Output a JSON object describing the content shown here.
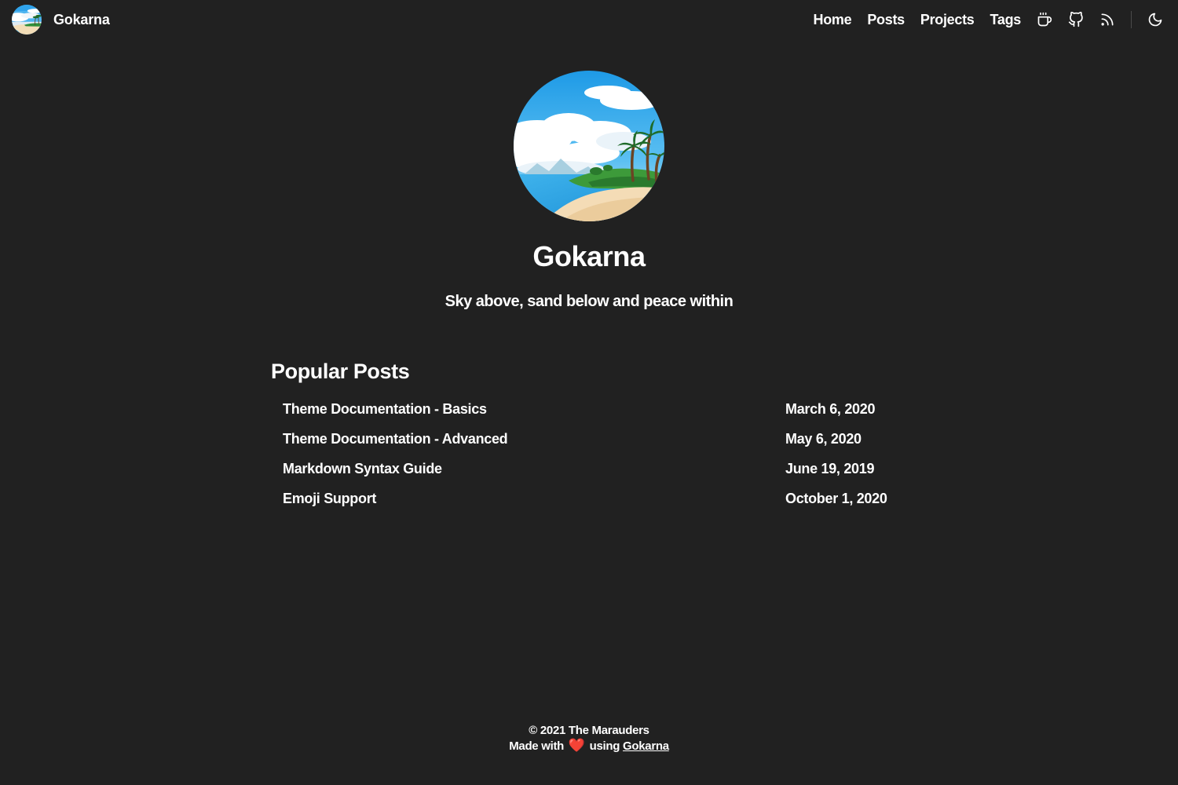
{
  "nav": {
    "brand_name": "Gokarna",
    "links": [
      {
        "label": "Home"
      },
      {
        "label": "Posts"
      },
      {
        "label": "Projects"
      },
      {
        "label": "Tags"
      }
    ],
    "icons": [
      "coffee-cup-icon",
      "github-icon",
      "rss-icon"
    ],
    "theme_toggle_icon": "moon-icon"
  },
  "hero": {
    "title": "Gokarna",
    "tagline": "Sky above, sand below and peace within"
  },
  "popular_posts": {
    "heading": "Popular Posts",
    "items": [
      {
        "title": "Theme Documentation - Basics",
        "date": "March 6, 2020"
      },
      {
        "title": "Theme Documentation - Advanced",
        "date": "May 6, 2020"
      },
      {
        "title": "Markdown Syntax Guide",
        "date": "June 19, 2019"
      },
      {
        "title": "Emoji Support",
        "date": "October 1, 2020"
      }
    ]
  },
  "footer": {
    "copyright": "© 2021 The Marauders",
    "made_with": "Made with",
    "heart": "❤️",
    "using": "using",
    "link_text": "Gokarna"
  },
  "colors": {
    "background": "#212121",
    "text": "#ffffff",
    "heart": "#e0262f"
  }
}
